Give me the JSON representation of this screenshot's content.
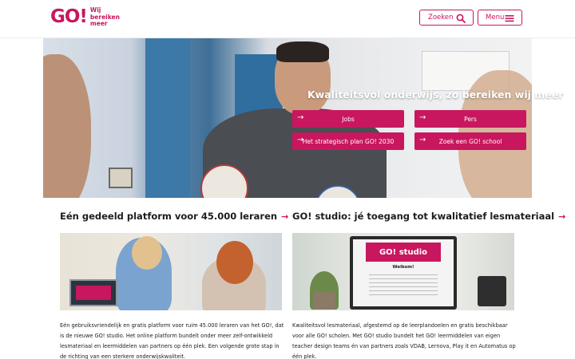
{
  "header": {
    "logo_mark": "GO!",
    "logo_tagline": [
      "Wij",
      "bereiken",
      "meer"
    ],
    "search_label": "Zoeken",
    "search_icon": "search-icon",
    "menu_label": "Menu",
    "menu_icon": "hamburger-icon"
  },
  "hero": {
    "title": "Kwaliteitsvol onderwijs, zo bereiken wij meer",
    "buttons": [
      {
        "label": "Jobs"
      },
      {
        "label": "Pers"
      },
      {
        "label": "Het strategisch plan GO! 2030"
      },
      {
        "label": "Zoek een GO! school"
      }
    ],
    "button_arrow": "→"
  },
  "cards": [
    {
      "title": "Eén gedeeld platform voor 45.000 leraren",
      "arrow": "→",
      "description": "Eén gebruiksvriendelijk en gratis platform voor ruim 45.000 leraren van het GO!, dat is de nieuwe GO! studio. Het online platform bundelt onder meer zelf-ontwikkeld lesmateriaal en leermiddelen van partners op één plek. Een volgende grote stap in de richting van een sterkere onderwijskwaliteit."
    },
    {
      "title": "GO! studio: jé toegang tot kwalitatief lesmateriaal",
      "arrow": "→",
      "description": "Kwaliteitsvol lesmateriaal, afgestemd op de leerplandoelen en gratis beschikbaar voor alle GO! scholen. Met GO! studio bundelt het GO! leermiddelen van eigen teacher design teams én van partners zoals VDAB, Lernova, Play it en Automatus op één plek.",
      "screen_brand": "GO! studio",
      "screen_greeting": "Welkom!"
    }
  ],
  "colors": {
    "brand": "#c8175e",
    "text": "#1d1d1b"
  }
}
